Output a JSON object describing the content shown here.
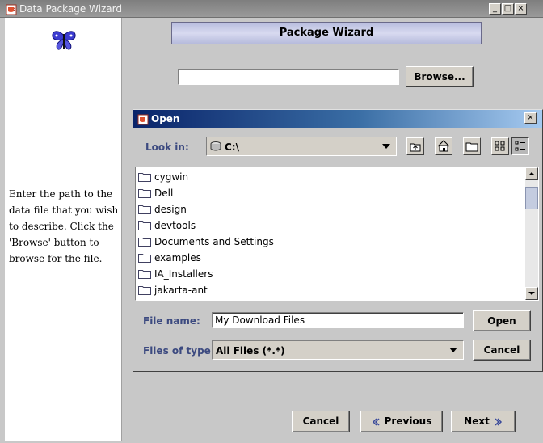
{
  "window": {
    "title": "Data Package Wizard"
  },
  "wizard": {
    "banner_title": "Package Wizard",
    "path_value": "",
    "browse_label": "Browse...",
    "instructions": "Enter the path to the data file that you wish to describe. Click the 'Browse' button to browse for the file.",
    "cancel_label": "Cancel",
    "previous_label": "Previous",
    "next_label": "Next"
  },
  "dialog": {
    "title": "Open",
    "look_in_label": "Look in:",
    "look_in_value": "C:\\",
    "files": [
      {
        "name": "cygwin"
      },
      {
        "name": "Dell"
      },
      {
        "name": "design"
      },
      {
        "name": "devtools"
      },
      {
        "name": "Documents and Settings"
      },
      {
        "name": "examples"
      },
      {
        "name": "IA_Installers"
      },
      {
        "name": "jakarta-ant"
      }
    ],
    "file_name_label": "File name:",
    "file_name_value": "My Download Files",
    "files_of_type_label": "Files of type:",
    "files_of_type_value": "All Files (*.*)",
    "open_label": "Open",
    "cancel_label": "Cancel"
  },
  "colors": {
    "accent_blue": "#0a246a",
    "label_color": "#3c4a80"
  }
}
